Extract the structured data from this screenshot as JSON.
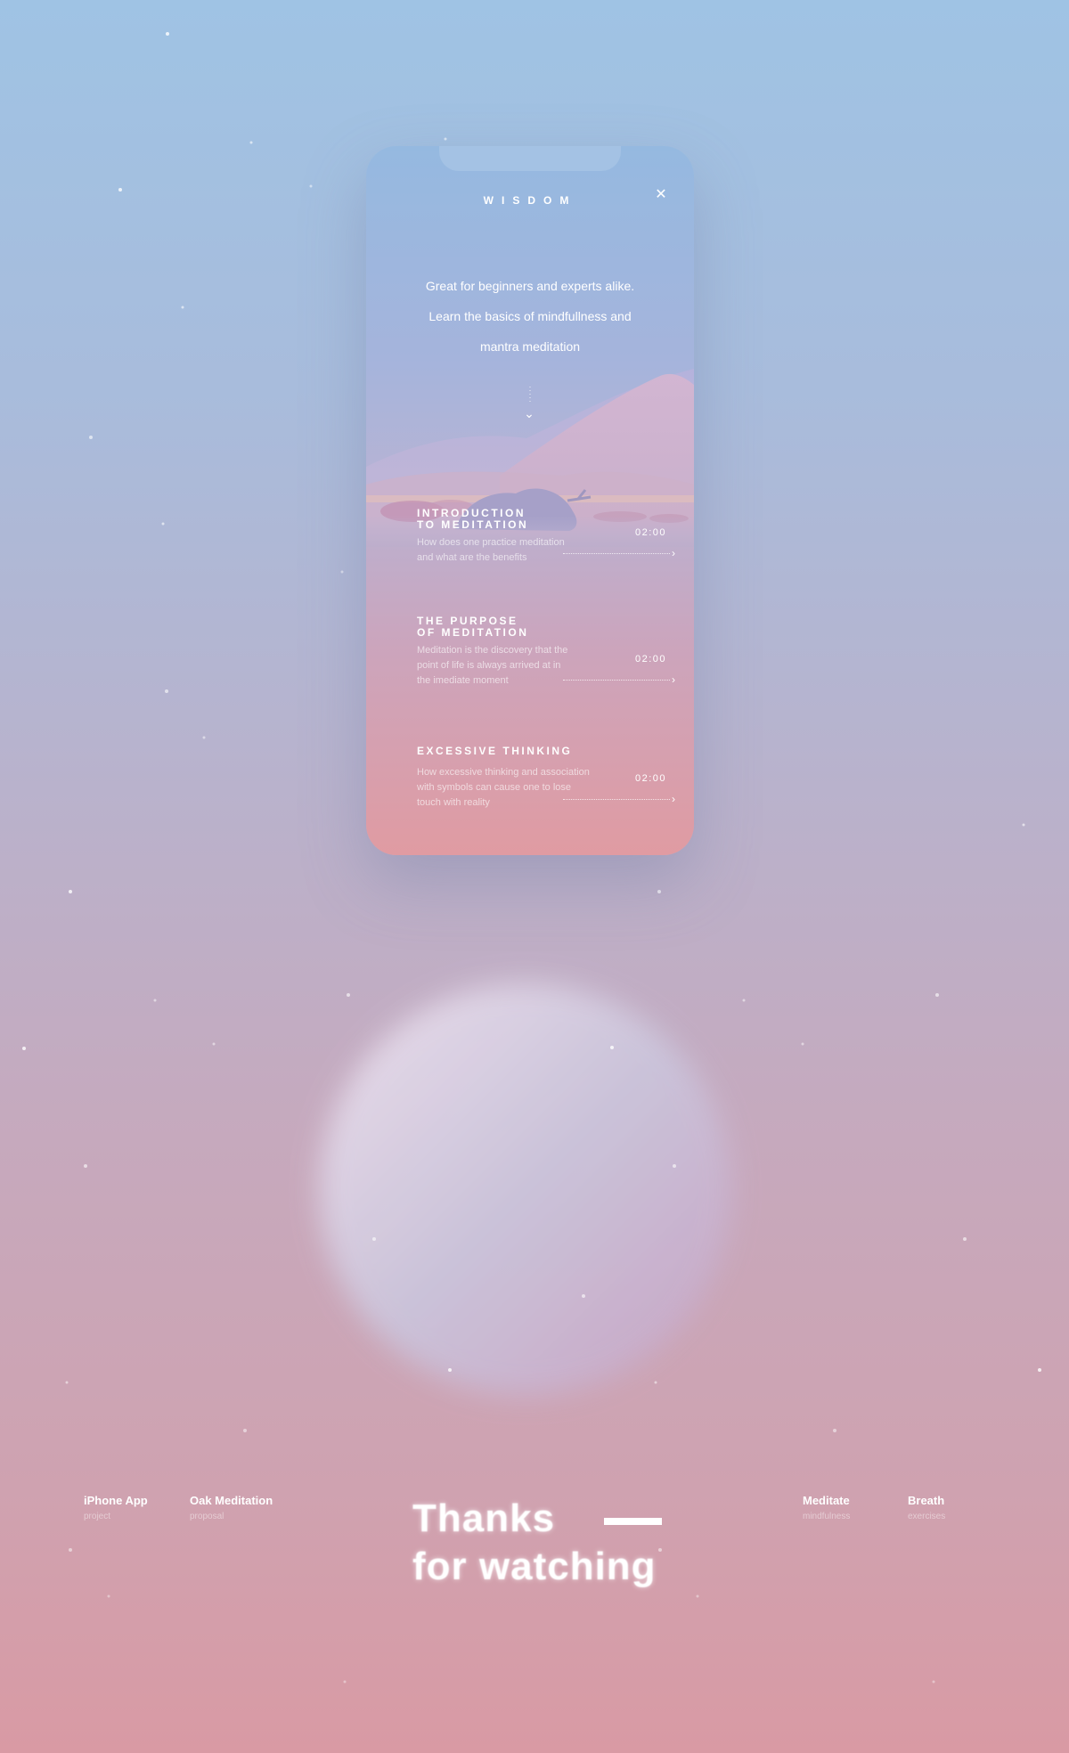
{
  "app": {
    "title": "WISDOM"
  },
  "intro": {
    "line1": "Great for beginners and experts alike.",
    "line2": "Learn the basics of mindfullness and",
    "line3": "mantra meditation"
  },
  "lessons": [
    {
      "title1": "INTRODUCTION",
      "title2": "TO MEDITATION",
      "desc1": "How does one practice meditation",
      "desc2": "and what are the benefits",
      "desc3": "",
      "time": "02:00"
    },
    {
      "title1": "THE PURPOSE",
      "title2": "OF MEDITATION",
      "desc1": "Meditation is the discovery that the",
      "desc2": "point of life  is always arrived at in",
      "desc3": "the imediate moment",
      "time": "02:00"
    },
    {
      "title1": "EXCESSIVE THINKING",
      "title2": "",
      "desc1": "How excessive thinking and association",
      "desc2": "with symbols can cause one to lose",
      "desc3": "touch with reality",
      "time": "02:00"
    }
  ],
  "footer": {
    "items": [
      {
        "label": "iPhone App",
        "sub": "project"
      },
      {
        "label": "Oak Meditation",
        "sub": "proposal"
      },
      {
        "label": "Meditate",
        "sub": "mindfulness"
      },
      {
        "label": "Breath",
        "sub": "exercises"
      }
    ],
    "thanks_line1": "Thanks",
    "thanks_line2": "for watching"
  },
  "icons": {
    "close": "close-icon",
    "scroll": "chevron-down-icon",
    "lesson_arrow": "chevron-right-icon"
  },
  "colors": {
    "sky_top": "#9fc3e4",
    "pink_bottom": "#d99aa4",
    "text": "#ffffff"
  }
}
